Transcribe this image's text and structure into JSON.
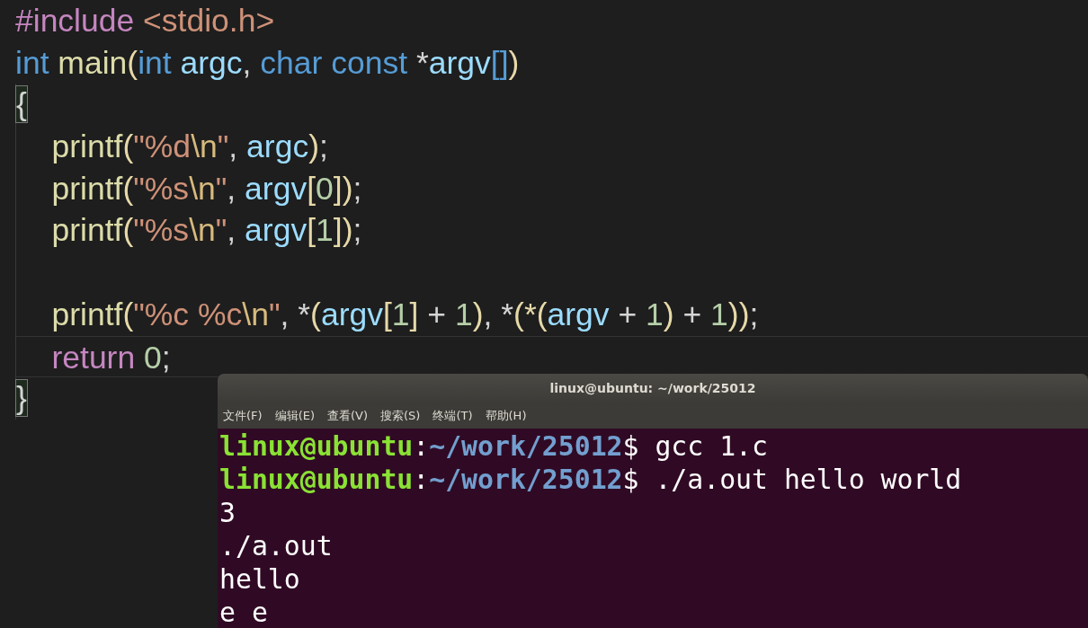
{
  "editor": {
    "lines": [
      {
        "current": false,
        "tokens": [
          {
            "t": "#include",
            "kind": "kw"
          },
          {
            "t": " <stdio.h>",
            "kind": "str"
          }
        ]
      },
      {
        "current": false,
        "tokens": [
          {
            "t": "int",
            "kind": "type"
          },
          {
            "t": " main",
            "kind": "fn"
          },
          {
            "t": "(",
            "kind": "bracket"
          },
          {
            "t": "int",
            "kind": "type"
          },
          {
            "t": " argc",
            "kind": "var"
          },
          {
            "t": ", ",
            "kind": "punc"
          },
          {
            "t": "char const",
            "kind": "type"
          },
          {
            "t": " *",
            "kind": "punc"
          },
          {
            "t": "argv",
            "kind": "var"
          },
          {
            "t": "[]",
            "kind": "type"
          },
          {
            "t": ")",
            "kind": "bracket"
          }
        ]
      },
      {
        "current": false,
        "tokens": [
          {
            "t": "{",
            "kind": "match"
          }
        ]
      },
      {
        "current": false,
        "tokens": [
          {
            "t": "    printf",
            "kind": "fn"
          },
          {
            "t": "(",
            "kind": "bracket"
          },
          {
            "t": "\"%d",
            "kind": "str"
          },
          {
            "t": "\\n",
            "kind": "esc"
          },
          {
            "t": "\"",
            "kind": "str"
          },
          {
            "t": ", ",
            "kind": "punc"
          },
          {
            "t": "argc",
            "kind": "var"
          },
          {
            "t": ")",
            "kind": "bracket"
          },
          {
            "t": ";",
            "kind": "punc"
          }
        ]
      },
      {
        "current": false,
        "tokens": [
          {
            "t": "    printf",
            "kind": "fn"
          },
          {
            "t": "(",
            "kind": "bracket"
          },
          {
            "t": "\"%s",
            "kind": "str"
          },
          {
            "t": "\\n",
            "kind": "esc"
          },
          {
            "t": "\"",
            "kind": "str"
          },
          {
            "t": ", ",
            "kind": "punc"
          },
          {
            "t": "argv",
            "kind": "var"
          },
          {
            "t": "[",
            "kind": "bracket"
          },
          {
            "t": "0",
            "kind": "num"
          },
          {
            "t": "]",
            "kind": "bracket"
          },
          {
            "t": ")",
            "kind": "bracket"
          },
          {
            "t": ";",
            "kind": "punc"
          }
        ]
      },
      {
        "current": false,
        "tokens": [
          {
            "t": "    printf",
            "kind": "fn"
          },
          {
            "t": "(",
            "kind": "bracket"
          },
          {
            "t": "\"%s",
            "kind": "str"
          },
          {
            "t": "\\n",
            "kind": "esc"
          },
          {
            "t": "\"",
            "kind": "str"
          },
          {
            "t": ", ",
            "kind": "punc"
          },
          {
            "t": "argv",
            "kind": "var"
          },
          {
            "t": "[",
            "kind": "bracket"
          },
          {
            "t": "1",
            "kind": "num"
          },
          {
            "t": "]",
            "kind": "bracket"
          },
          {
            "t": ")",
            "kind": "bracket"
          },
          {
            "t": ";",
            "kind": "punc"
          }
        ]
      },
      {
        "current": false
      },
      {
        "current": false,
        "tokens": [
          {
            "t": "    printf",
            "kind": "fn"
          },
          {
            "t": "(",
            "kind": "bracket"
          },
          {
            "t": "\"%c %c",
            "kind": "str"
          },
          {
            "t": "\\n",
            "kind": "esc"
          },
          {
            "t": "\"",
            "kind": "str"
          },
          {
            "t": ", *",
            "kind": "punc"
          },
          {
            "t": "(",
            "kind": "bracket"
          },
          {
            "t": "argv",
            "kind": "var"
          },
          {
            "t": "[",
            "kind": "bracket"
          },
          {
            "t": "1",
            "kind": "num"
          },
          {
            "t": "]",
            "kind": "bracket"
          },
          {
            "t": " + ",
            "kind": "punc"
          },
          {
            "t": "1",
            "kind": "num"
          },
          {
            "t": ")",
            "kind": "bracket"
          },
          {
            "t": ", *",
            "kind": "punc"
          },
          {
            "t": "(*(",
            "kind": "bracket"
          },
          {
            "t": "argv",
            "kind": "var"
          },
          {
            "t": " + ",
            "kind": "punc"
          },
          {
            "t": "1",
            "kind": "num"
          },
          {
            "t": ")",
            "kind": "bracket"
          },
          {
            "t": " + ",
            "kind": "punc"
          },
          {
            "t": "1",
            "kind": "num"
          },
          {
            "t": "))",
            "kind": "bracket"
          },
          {
            "t": ";",
            "kind": "punc"
          }
        ]
      },
      {
        "current": true,
        "tokens": [
          {
            "t": "    return",
            "kind": "kw"
          },
          {
            "t": " 0",
            "kind": "num"
          },
          {
            "t": ";",
            "kind": "punc"
          }
        ]
      },
      {
        "current": false,
        "tokens": [
          {
            "t": "}",
            "kind": "match"
          }
        ]
      }
    ]
  },
  "terminal": {
    "title": "linux@ubuntu: ~/work/25012",
    "menu": [
      "文件(F)",
      "编辑(E)",
      "查看(V)",
      "搜索(S)",
      "终端(T)",
      "帮助(H)"
    ],
    "lines": [
      {
        "kind": "prompt",
        "user": "linux@ubuntu",
        "sep": ":",
        "path": "~/work/25012",
        "command": "$ gcc 1.c"
      },
      {
        "kind": "prompt",
        "user": "linux@ubuntu",
        "sep": ":",
        "path": "~/work/25012",
        "command": "$ ./a.out hello world"
      },
      {
        "kind": "output",
        "text": "3"
      },
      {
        "kind": "output",
        "text": "./a.out"
      },
      {
        "kind": "output",
        "text": "hello"
      },
      {
        "kind": "output",
        "text": "e e"
      }
    ]
  }
}
